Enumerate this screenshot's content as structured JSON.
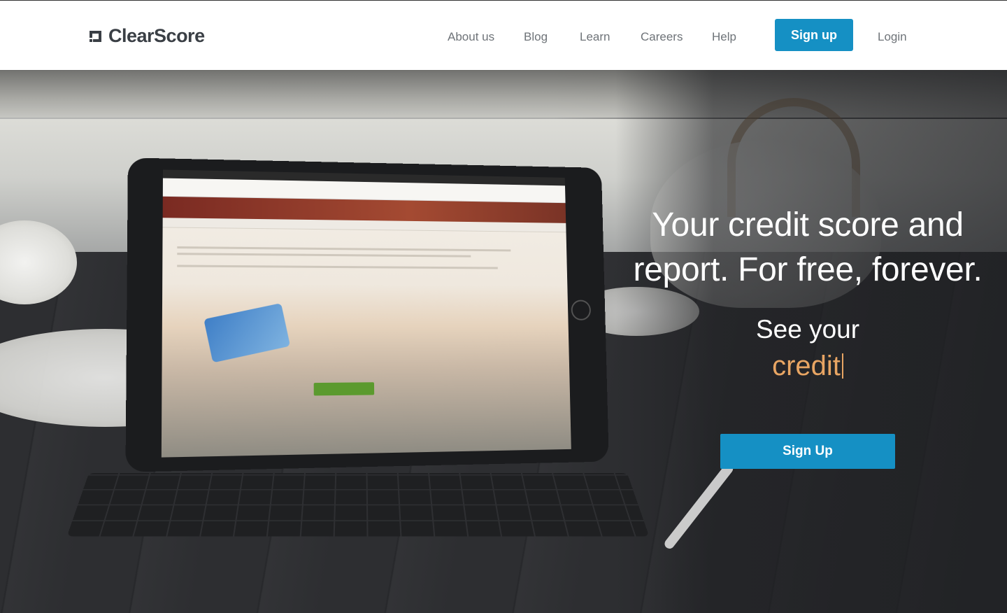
{
  "header": {
    "brand": "ClearScore",
    "nav": [
      {
        "label": "About us"
      },
      {
        "label": "Blog"
      },
      {
        "label": "Learn"
      },
      {
        "label": "Careers"
      },
      {
        "label": "Help"
      }
    ],
    "signup_label": "Sign up",
    "login_label": "Login"
  },
  "hero": {
    "title": "Your credit score and report. For free, forever.",
    "subtitle": "See your",
    "typed_word": "credit",
    "cta_label": "Sign Up"
  },
  "colors": {
    "brand_blue": "#1590c4",
    "accent_orange": "#e8a563",
    "logo_text": "#3a3f45",
    "nav_text": "#6e7378"
  },
  "icons": {
    "logo_mark": "clearscore-logo-icon"
  }
}
